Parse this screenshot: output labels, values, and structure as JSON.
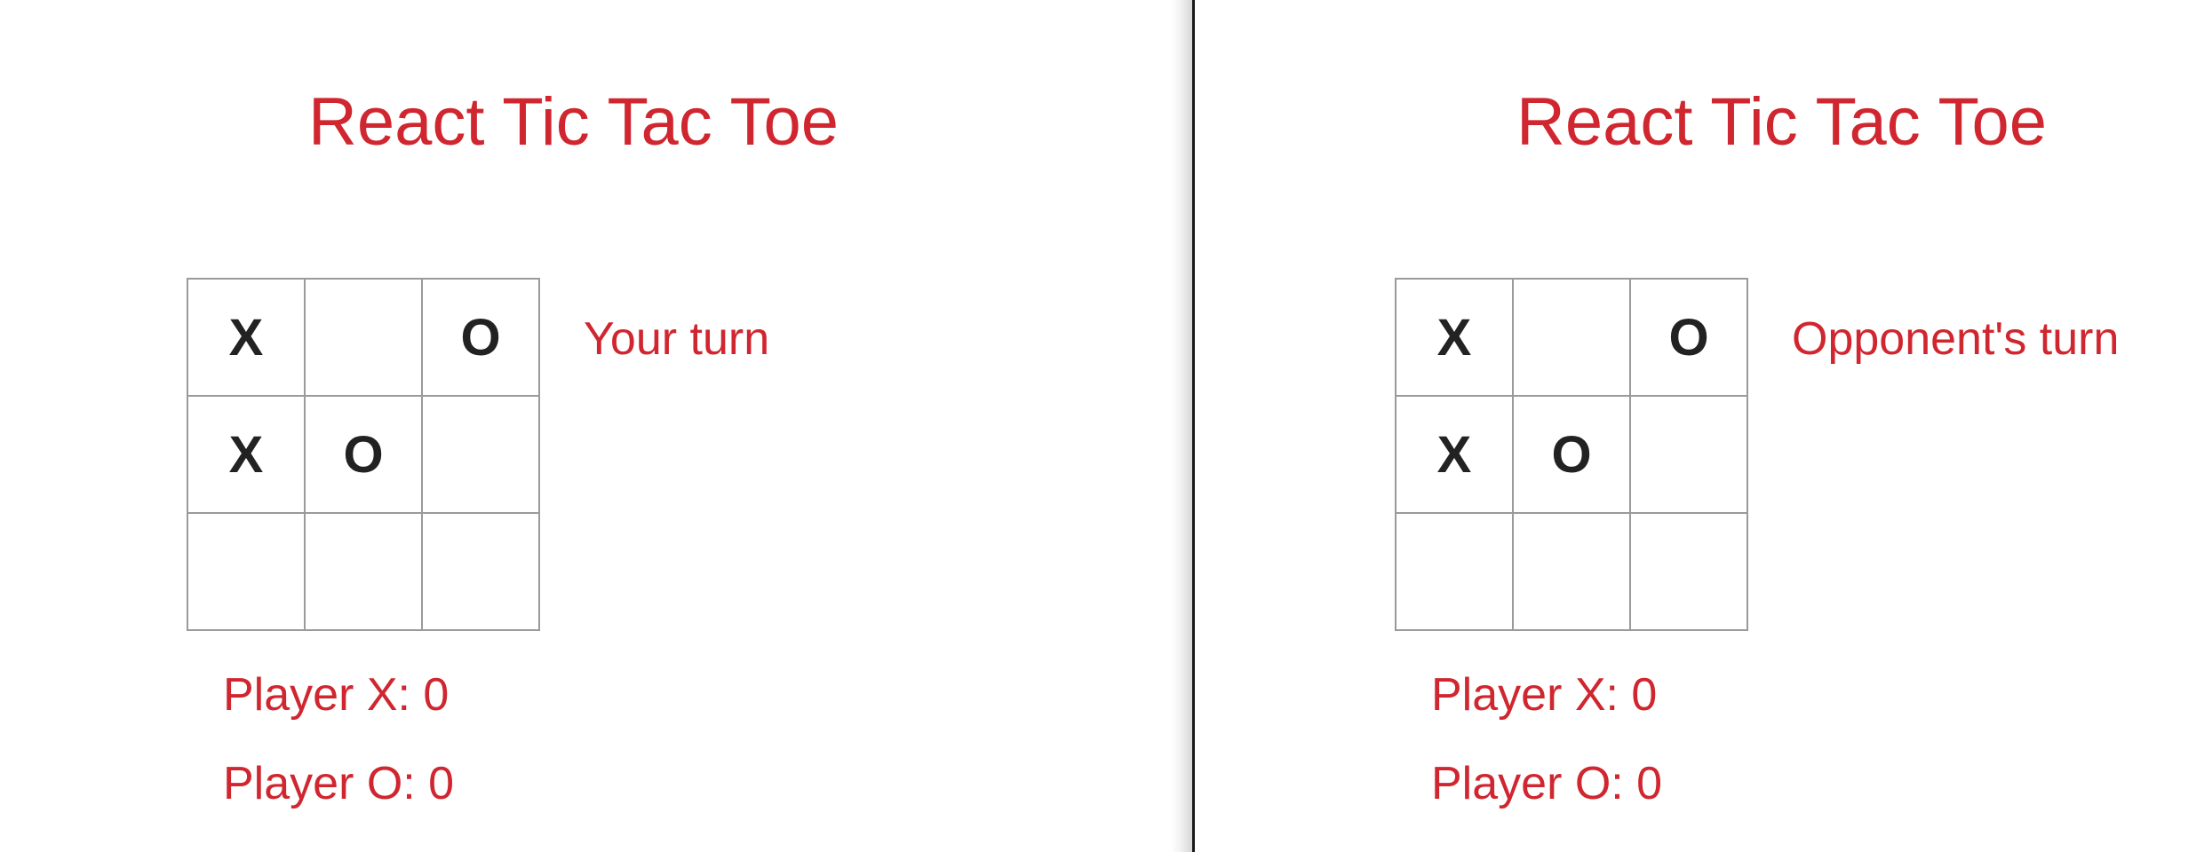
{
  "colors": {
    "accent": "#d0262f",
    "mark": "#222222",
    "grid": "#9a9a9a"
  },
  "windows": [
    {
      "title": "React Tic Tac Toe",
      "board": [
        [
          "X",
          "",
          "O"
        ],
        [
          "X",
          "O",
          ""
        ],
        [
          "",
          "",
          ""
        ]
      ],
      "status": "Your turn",
      "scores": {
        "x": "Player X: 0",
        "o": "Player O: 0"
      }
    },
    {
      "title": "React Tic Tac Toe",
      "board": [
        [
          "X",
          "",
          "O"
        ],
        [
          "X",
          "O",
          ""
        ],
        [
          "",
          "",
          ""
        ]
      ],
      "status": "Opponent's turn",
      "scores": {
        "x": "Player X: 0",
        "o": "Player O: 0"
      }
    }
  ]
}
